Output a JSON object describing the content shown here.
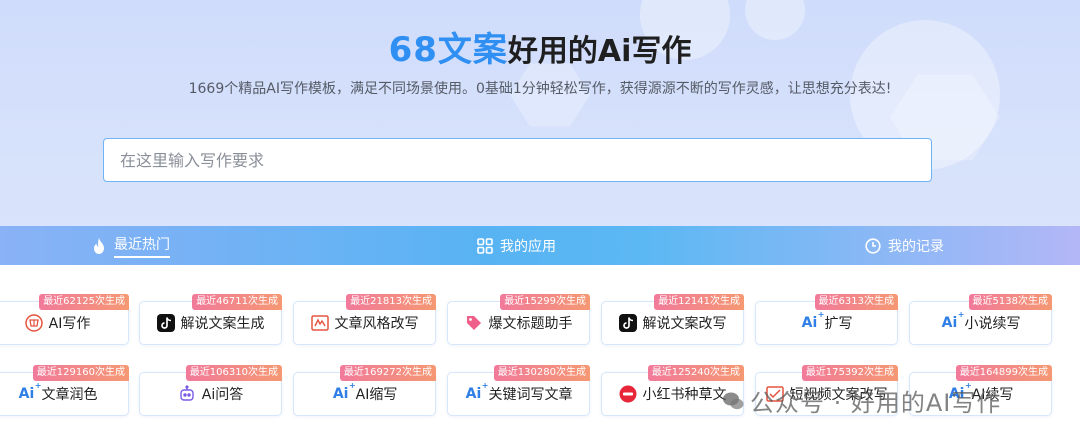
{
  "hero": {
    "brand": "68文案",
    "title_rest": "好用的Ai写作",
    "subtitle": "1669个精品AI写作模板，满足不同场景使用。0基础1分钟轻松写作，获得源源不断的写作灵感，让思想充分表达!"
  },
  "search": {
    "placeholder": "在这里输入写作要求"
  },
  "tabs": [
    {
      "label": "最近热门",
      "icon": "flame-icon"
    },
    {
      "label": "我的应用",
      "icon": "grid-icon"
    },
    {
      "label": "我的记录",
      "icon": "clock-icon"
    }
  ],
  "cards": [
    {
      "label": "AI写作",
      "badge": "最近62125次生成",
      "icon": "ai-write-icon"
    },
    {
      "label": "解说文案生成",
      "badge": "最近46711次生成",
      "icon": "douyin-icon"
    },
    {
      "label": "文章风格改写",
      "badge": "最近21813次生成",
      "icon": "rewrite-icon"
    },
    {
      "label": "爆文标题助手",
      "badge": "最近15299次生成",
      "icon": "tag-icon"
    },
    {
      "label": "解说文案改写",
      "badge": "最近12141次生成",
      "icon": "douyin-icon"
    },
    {
      "label": "扩写",
      "badge": "最近6313次生成",
      "icon": "ai-icon"
    },
    {
      "label": "小说续写",
      "badge": "最近5138次生成",
      "icon": "ai-icon"
    },
    {
      "label": "文章润色",
      "badge": "最近129160次生成",
      "icon": "ai-icon"
    },
    {
      "label": "Ai问答",
      "badge": "最近106310次生成",
      "icon": "robot-icon"
    },
    {
      "label": "AI缩写",
      "badge": "最近169272次生成",
      "icon": "ai-icon"
    },
    {
      "label": "关键词写文章",
      "badge": "最近130280次生成",
      "icon": "ai-icon"
    },
    {
      "label": "小红书种草文",
      "badge": "最近125240次生成",
      "icon": "xiaohongshu-icon"
    },
    {
      "label": "短视频文案改写",
      "badge": "最近175392次生成",
      "icon": "video-icon"
    },
    {
      "label": "AI续写",
      "badge": "最近164899次生成",
      "icon": "ai-icon"
    }
  ],
  "watermark": {
    "text": "公众号 · 好用的AI写作"
  },
  "colors": {
    "brand": "#2f8ff2",
    "badge_start": "#f17a9a",
    "badge_end": "#f59873",
    "tab_blue": "#58b3f3"
  }
}
